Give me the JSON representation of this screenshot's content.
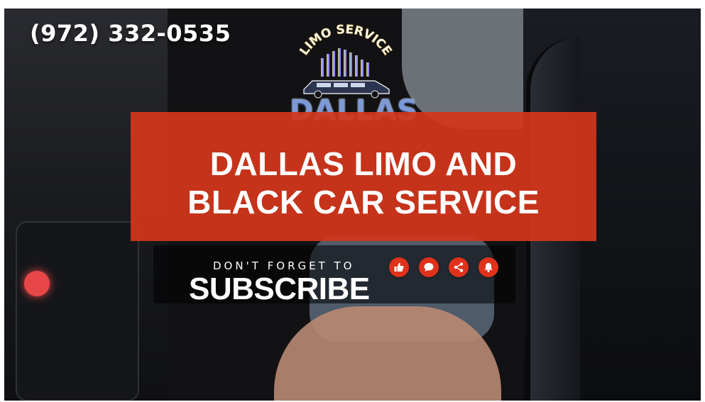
{
  "phone": "(972) 332-0535",
  "logo": {
    "arc_text": "LIMO SERVICE",
    "word": "DALLAS"
  },
  "headline": {
    "line1": "DALLAS LIMO AND",
    "line2": "BLACK CAR SERVICE"
  },
  "cta": {
    "small": "DON'T FORGET TO",
    "big": "SUBSCRIBE"
  },
  "actions": [
    {
      "icon": "thumbs-up-icon"
    },
    {
      "icon": "comment-icon"
    },
    {
      "icon": "share-icon"
    },
    {
      "icon": "bell-icon"
    }
  ],
  "colors": {
    "banner": "#d3361b",
    "action_buttons": "#e0321b",
    "logo_blue": "#7d9ad6",
    "text": "#ffffff"
  }
}
